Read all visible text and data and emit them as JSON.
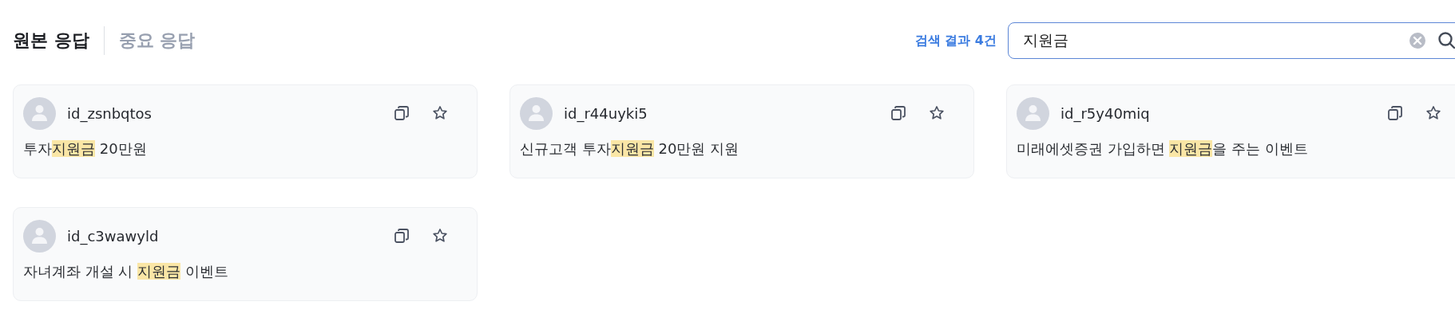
{
  "tabs": [
    {
      "label": "원본 응답",
      "selected": true
    },
    {
      "label": "중요 응답",
      "selected": false
    }
  ],
  "search": {
    "result_count": "검색 결과 4건",
    "value": "지원금"
  },
  "responses": [
    {
      "user": "id_zsnbqtos",
      "segments": [
        {
          "text": "투자",
          "highlighted": false
        },
        {
          "text": "지원금",
          "highlighted": true
        },
        {
          "text": " 20만원",
          "highlighted": false
        }
      ]
    },
    {
      "user": "id_r44uyki5",
      "segments": [
        {
          "text": "신규고객 투자",
          "highlighted": false
        },
        {
          "text": "지원금",
          "highlighted": true
        },
        {
          "text": " 20만원 지원",
          "highlighted": false
        }
      ]
    },
    {
      "user": "id_r5y40miq",
      "segments": [
        {
          "text": "미래에셋증권 가입하면 ",
          "highlighted": false
        },
        {
          "text": "지원금",
          "highlighted": true
        },
        {
          "text": "을 주는 이벤트",
          "highlighted": false
        }
      ]
    },
    {
      "user": "id_c3wawyld",
      "segments": [
        {
          "text": "자녀계좌 개설 시 ",
          "highlighted": false
        },
        {
          "text": "지원금",
          "highlighted": true
        },
        {
          "text": " 이벤트",
          "highlighted": false
        }
      ]
    }
  ]
}
